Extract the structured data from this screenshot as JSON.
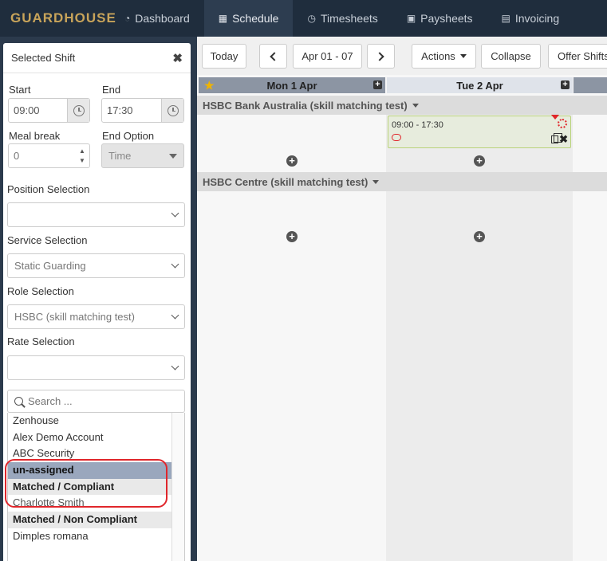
{
  "nav": {
    "logo": "GUARDHOUSE",
    "items": [
      {
        "label": "Dashboard",
        "icon": "dashboard-icon",
        "active": false
      },
      {
        "label": "Schedule",
        "icon": "calendar-icon",
        "active": true
      },
      {
        "label": "Timesheets",
        "icon": "clock-icon",
        "active": false
      },
      {
        "label": "Paysheets",
        "icon": "money-icon",
        "active": false
      },
      {
        "label": "Invoicing",
        "icon": "invoice-icon",
        "active": false
      }
    ]
  },
  "sidebar": {
    "title": "Selected Shift",
    "start_label": "Start",
    "start_value": "09:00",
    "end_label": "End",
    "end_value": "17:30",
    "meal_label": "Meal break",
    "meal_value": "0",
    "end_option_label": "End Option",
    "end_option_value": "Time",
    "position_label": "Position Selection",
    "position_value": "",
    "service_label": "Service Selection",
    "service_value": "Static Guarding",
    "role_label": "Role Selection",
    "role_value": "HSBC (skill matching test)",
    "rate_label": "Rate Selection",
    "rate_value": "",
    "search_placeholder": "Search ...",
    "list": [
      {
        "label": "Zenhouse",
        "kind": "item"
      },
      {
        "label": "Alex Demo Account",
        "kind": "item"
      },
      {
        "label": "ABC Security",
        "kind": "item"
      },
      {
        "label": "un-assigned",
        "kind": "selected"
      },
      {
        "label": "Matched / Compliant",
        "kind": "group"
      },
      {
        "label": "Charlotte Smith",
        "kind": "item"
      },
      {
        "label": "Matched / Non Compliant",
        "kind": "group"
      },
      {
        "label": "Dimples romana",
        "kind": "item"
      }
    ]
  },
  "toolbar": {
    "today": "Today",
    "range": "Apr 01 - 07",
    "actions": "Actions",
    "collapse": "Collapse",
    "offer": "Offer Shifts"
  },
  "days": {
    "mon": "Mon 1 Apr",
    "tue": "Tue 2 Apr"
  },
  "sites": [
    {
      "name": "HSBC Bank Australia (skill matching test)"
    },
    {
      "name": "HSBC Centre (skill matching test)"
    }
  ],
  "shift": {
    "time": "09:00 - 17:30"
  },
  "colors": {
    "nav_bg": "#1f2d3d",
    "logo": "#c8a45a",
    "selected_row": "#9aa7bd",
    "alert": "#e0262b",
    "shift_border": "#b9d27a"
  }
}
